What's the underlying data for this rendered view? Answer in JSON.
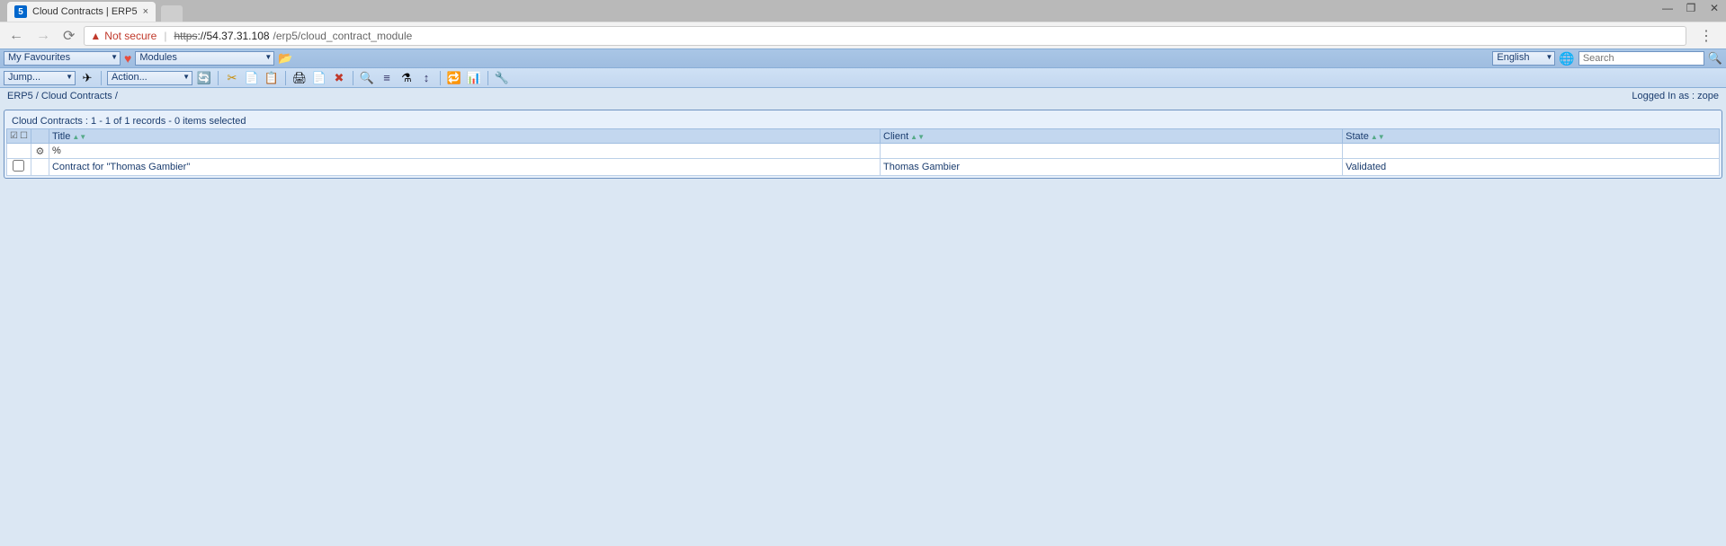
{
  "browser": {
    "tab_title": "Cloud Contracts | ERP5",
    "not_secure_label": "Not secure",
    "url_scheme": "https",
    "url_host": "://54.37.31.108",
    "url_path": "/erp5/cloud_contract_module"
  },
  "topbar": {
    "favourites_label": "My Favourites",
    "modules_label": "Modules",
    "language_label": "English",
    "search_placeholder": "Search"
  },
  "toolbar": {
    "jump_label": "Jump...",
    "action_label": "Action..."
  },
  "breadcrumb": {
    "root": "ERP5",
    "module": "Cloud Contracts",
    "trailing": "/"
  },
  "login": {
    "prefix": "Logged In as : ",
    "user": "zope"
  },
  "listbox": {
    "title": "Cloud Contracts",
    "summary": " :  1 - 1 of 1 records - 0 items selected",
    "columns": {
      "title": "Title",
      "client": "Client",
      "state": "State"
    },
    "filters": {
      "title": "%",
      "client": "",
      "state": ""
    },
    "rows": [
      {
        "title": "Contract for \"Thomas Gambier\"",
        "client": "Thomas Gambier",
        "state": "Validated"
      }
    ]
  }
}
